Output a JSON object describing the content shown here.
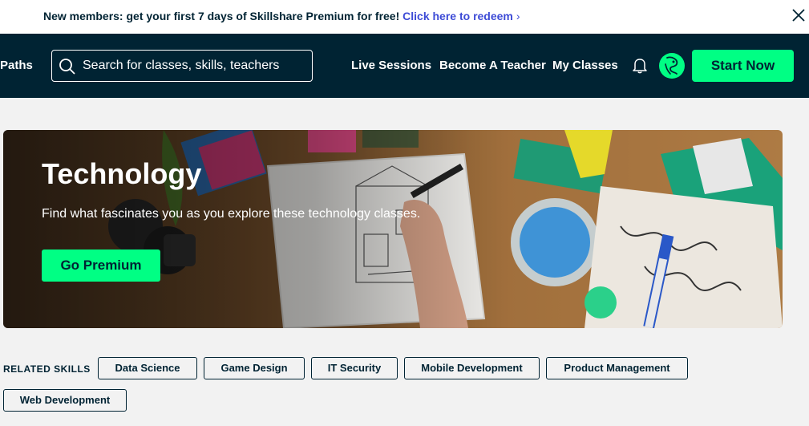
{
  "promo": {
    "text": "New members: get your first 7 days of Skillshare Premium for free!",
    "link": "Click here to redeem",
    "chevron": "›"
  },
  "nav": {
    "paths": "Paths",
    "search_placeholder": "Search for classes, skills, teachers",
    "live_sessions": "Live Sessions",
    "become_teacher": "Become A Teacher",
    "my_classes": "My Classes",
    "start_now": "Start Now"
  },
  "hero": {
    "title": "Technology",
    "subtitle": "Find what fascinates you as you explore these technology classes.",
    "cta": "Go Premium"
  },
  "related": {
    "label": "RELATED SKILLS",
    "skills": [
      "Data Science",
      "Game Design",
      "IT Security",
      "Mobile Development",
      "Product Management",
      "Web Development"
    ]
  },
  "colors": {
    "navy": "#002333",
    "accent_green": "#00ff84",
    "link_blue": "#3d4bd6",
    "page_bg": "#f2f2f2"
  },
  "icons": {
    "search": "search-icon",
    "bell": "bell-icon",
    "close": "close-icon",
    "avatar": "avatar"
  }
}
